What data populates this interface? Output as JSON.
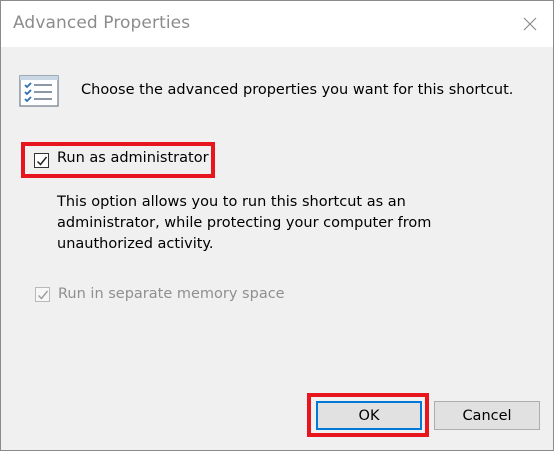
{
  "window": {
    "title": "Advanced Properties"
  },
  "intro_text": "Choose the advanced properties you want for this shortcut.",
  "options": {
    "run_as_admin": {
      "label": "Run as administrator",
      "checked": true,
      "enabled": true
    },
    "run_as_admin_description": "This option allows you to run this shortcut as an administrator, while protecting your computer from unauthorized activity.",
    "separate_memory": {
      "label": "Run in separate memory space",
      "checked": true,
      "enabled": false
    }
  },
  "buttons": {
    "ok_label": "OK",
    "cancel_label": "Cancel"
  },
  "icons": {
    "close": "close-icon",
    "properties": "properties-list-icon",
    "check": "checkmark-icon"
  },
  "colors": {
    "highlight": "#e8141e",
    "focus": "#0078d7",
    "disabled_text": "#8f8f8f"
  }
}
